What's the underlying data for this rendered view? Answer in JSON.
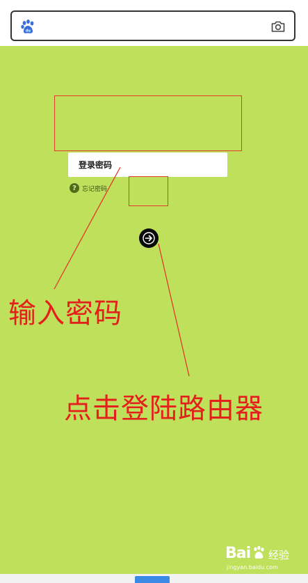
{
  "search_bar": {
    "logo_icon": "baidu-paw-icon",
    "camera_icon": "camera-icon"
  },
  "login_form": {
    "password_placeholder": "登录密码",
    "forgot_password_label": "忘记密码",
    "help_icon_glyph": "?",
    "submit_icon": "arrow-right-icon"
  },
  "annotations": {
    "enter_password": "输入密码",
    "click_login_router": "点击登陆路由器"
  },
  "watermark": {
    "brand": "Bai",
    "brand_suffix": "经验",
    "url": "jingyan.baidu.com"
  },
  "colors": {
    "page_background": "#bfe05a",
    "annotation_red": "#e3201c",
    "button_black": "#0a0a0a",
    "bottom_tab_blue": "#3b8be6"
  }
}
